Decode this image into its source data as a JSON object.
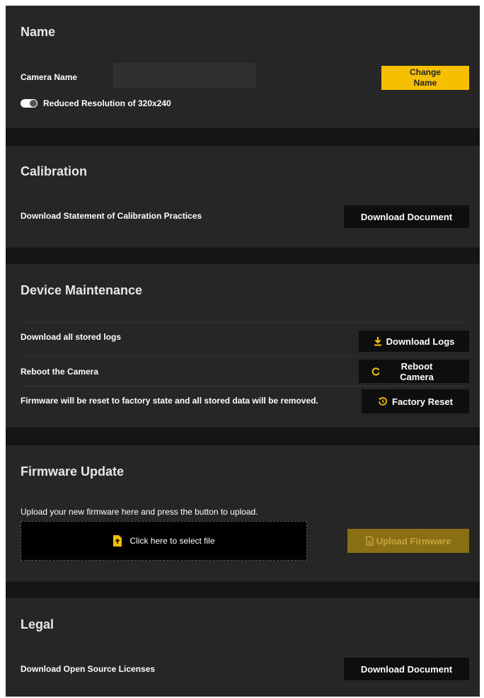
{
  "name_section": {
    "title": "Name",
    "camera_name_label": "Camera Name",
    "camera_name_value": "",
    "change_name_button": "Change Name",
    "reduced_resolution_label": "Reduced Resolution of 320x240"
  },
  "calibration_section": {
    "title": "Calibration",
    "download_statement_label": "Download Statement of Calibration Practices",
    "download_document_button": "Download Document"
  },
  "maintenance_section": {
    "title": "Device Maintenance",
    "rows": [
      {
        "label": "Download all stored logs",
        "button": "Download Logs",
        "icon": "download-icon"
      },
      {
        "label": "Reboot the Camera",
        "button": "Reboot Camera",
        "icon": "refresh-icon"
      },
      {
        "label": "Firmware will be reset to factory state and all stored data will be removed.",
        "button": "Factory Reset",
        "icon": "reset-icon"
      }
    ]
  },
  "firmware_section": {
    "title": "Firmware Update",
    "instruction": "Upload your new firmware here and press the button to upload.",
    "dropzone_label": "Click here to select file",
    "upload_button": "Upload Firmware"
  },
  "legal_section": {
    "title": "Legal",
    "licenses_label": "Download Open Source Licenses",
    "download_document_button": "Download Document"
  },
  "colors": {
    "accent": "#f6c000",
    "panel": "#262626",
    "background": "#151515"
  }
}
